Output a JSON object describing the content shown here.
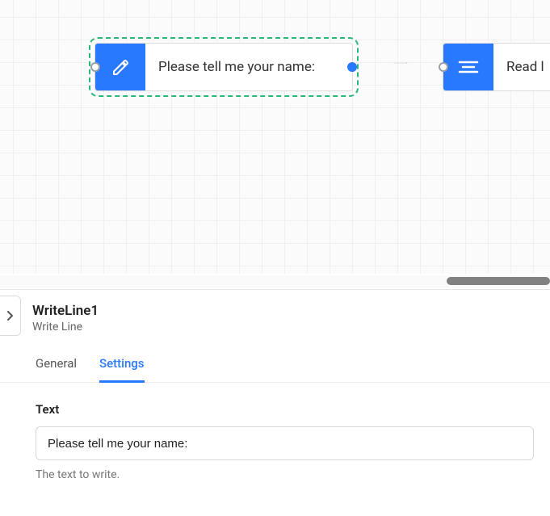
{
  "canvas": {
    "nodes": {
      "writeline": {
        "label": "Please tell me your name:",
        "icon": "pencil-icon",
        "selected": true
      },
      "readline": {
        "label": "Read l",
        "icon": "lines-icon",
        "selected": false
      }
    }
  },
  "panel": {
    "title": "WriteLine1",
    "subtitle": "Write Line",
    "tabs": {
      "general": "General",
      "settings": "Settings",
      "active": "settings"
    },
    "settings": {
      "field_label": "Text",
      "field_value": "Please tell me your name:",
      "field_help": "The text to write."
    }
  }
}
